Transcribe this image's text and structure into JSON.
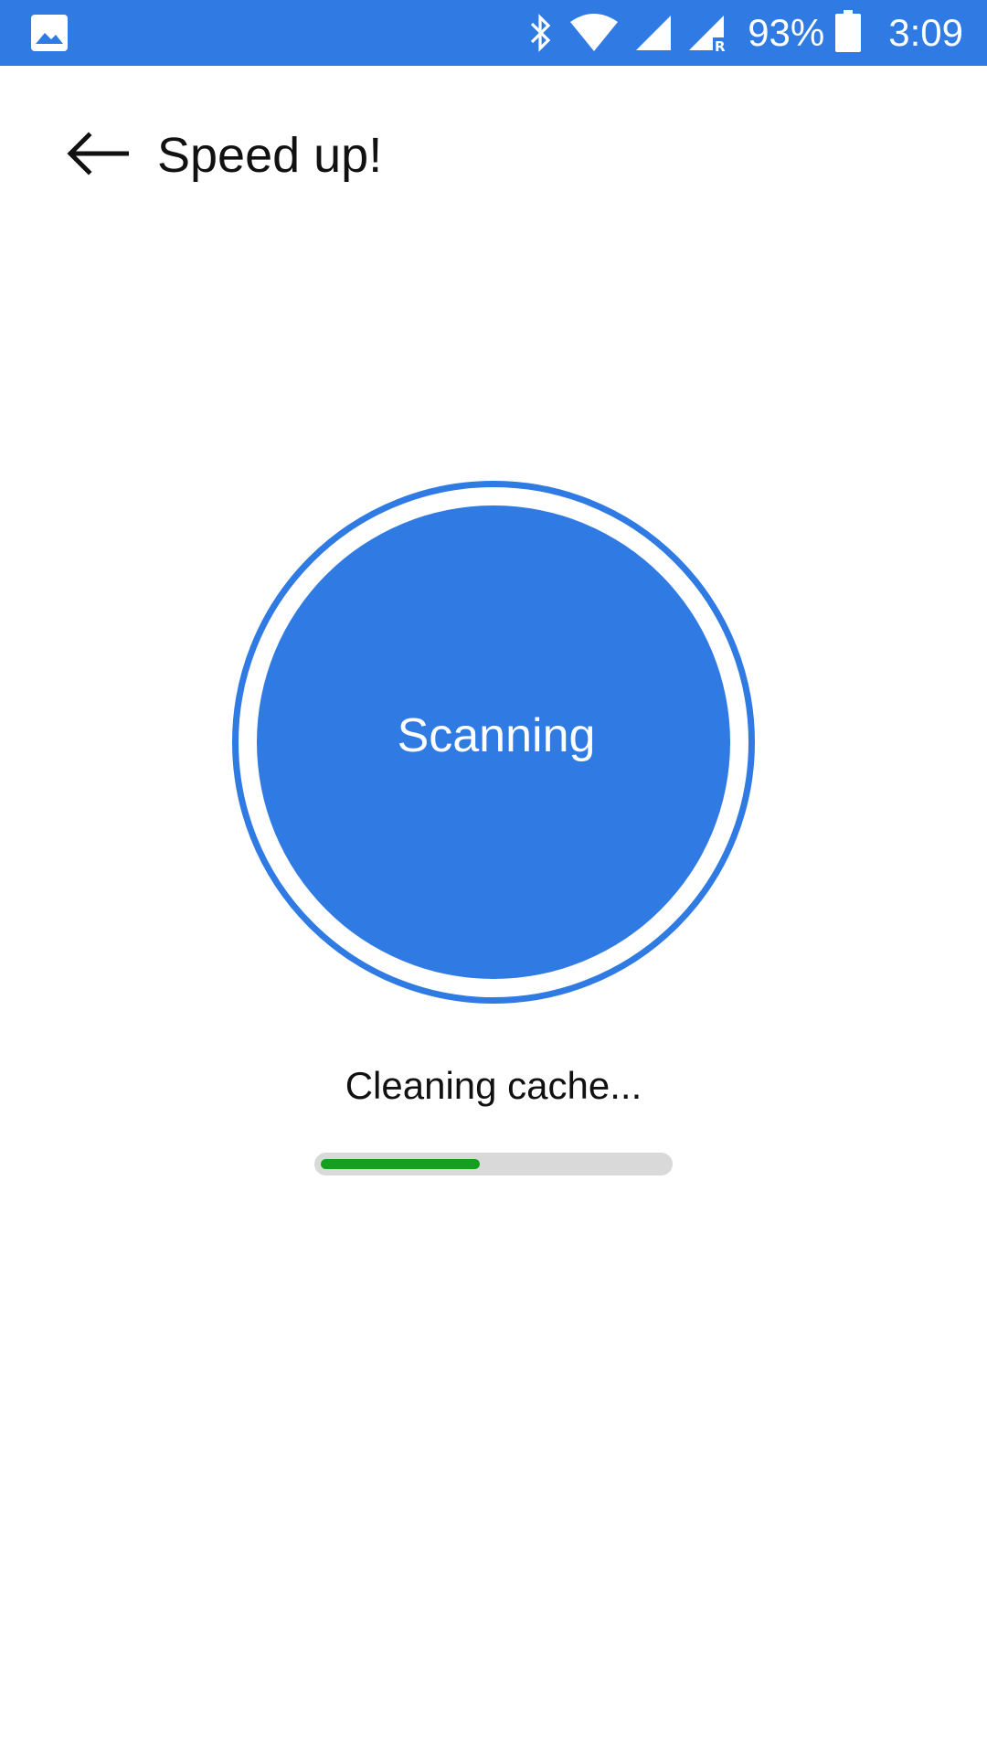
{
  "status_bar": {
    "battery_percent": "93%",
    "time": "3:09",
    "icons": [
      "gallery-notification-icon",
      "bluetooth-icon",
      "wifi-icon",
      "cell-signal-icon",
      "cell-signal-roaming-icon",
      "battery-icon"
    ],
    "color": "#2f7be3"
  },
  "app_bar": {
    "back_icon": "arrow-left-icon",
    "title": "Speed up!"
  },
  "scanner": {
    "label": "Scanning",
    "color": "#2f7be3"
  },
  "task": {
    "status": "Cleaning cache...",
    "progress": 0.46,
    "progress_color": "#14a01e",
    "track_color": "#d9d9d9"
  }
}
